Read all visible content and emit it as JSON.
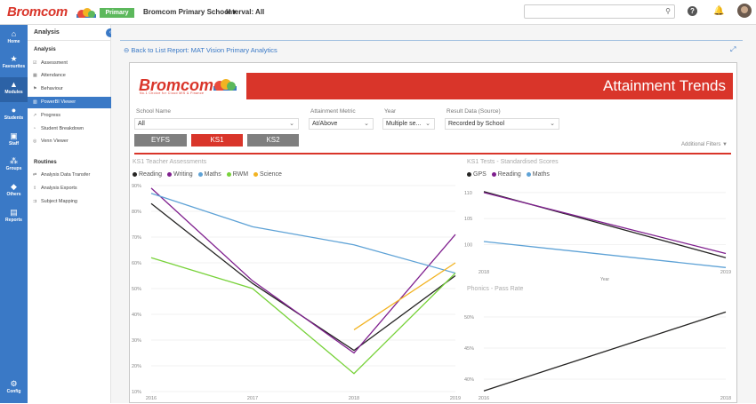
{
  "app": {
    "logo_text": "Bromcom",
    "env_badge": "Primary",
    "school_selector": "Bromcom Primary School",
    "interval": "Interval: All"
  },
  "search": {
    "placeholder": ""
  },
  "rail": [
    {
      "icon": "home-icon",
      "label": "Home"
    },
    {
      "icon": "star-icon",
      "label": "Favourites"
    },
    {
      "icon": "modules-icon",
      "label": "Modules"
    },
    {
      "icon": "students-icon",
      "label": "Students"
    },
    {
      "icon": "staff-icon",
      "label": "Staff"
    },
    {
      "icon": "groups-icon",
      "label": "Groups"
    },
    {
      "icon": "others-icon",
      "label": "Others"
    },
    {
      "icon": "reports-icon",
      "label": "Reports"
    },
    {
      "icon": "config-icon",
      "label": "Config"
    }
  ],
  "sidebar": {
    "heading": "Analysis",
    "section1": "Analysis",
    "items": [
      "Assessment",
      "Attendance",
      "Behaviour",
      "PowerBI Viewer",
      "Progress",
      "Student Breakdown",
      "Venn Viewer"
    ],
    "section2": "Routines",
    "routines": [
      "Analysis Data Transfer",
      "Analysis Exports",
      "Subject Mapping"
    ]
  },
  "content": {
    "back": "Back to List",
    "report": "Report: MAT Vision Primary Analytics"
  },
  "report": {
    "logo": "Bromcom",
    "tagline": "No.1 Choice for Cloud MIS & Finance",
    "title": "Attainment Trends",
    "filters": [
      {
        "label": "School Name",
        "value": "All"
      },
      {
        "label": "Attainment Metric",
        "value": "At/Above"
      },
      {
        "label": "Year",
        "value": "Multiple se..."
      },
      {
        "label": "Result Data (Source)",
        "value": "Recorded by School"
      }
    ],
    "stage_buttons": [
      "EYFS",
      "KS1",
      "KS2"
    ],
    "additional_filters": "Additional Filters ▼"
  },
  "colors": {
    "brand_red": "#d9352a",
    "nav_blue": "#3a79c6",
    "badge_green": "#5cb85c"
  },
  "chart_data": [
    {
      "type": "line",
      "title": "KS1 Teacher Assessments",
      "x": [
        "2016",
        "2017",
        "2018",
        "2019"
      ],
      "ylim": [
        10,
        90
      ],
      "yticks": [
        "90%",
        "80%",
        "70%",
        "60%",
        "50%",
        "40%",
        "30%",
        "20%",
        "10%"
      ],
      "series": [
        {
          "name": "Reading",
          "color": "#252423",
          "values": [
            83,
            52,
            26,
            55
          ]
        },
        {
          "name": "Writing",
          "color": "#7f1f8e",
          "values": [
            89,
            53,
            25,
            71
          ]
        },
        {
          "name": "Maths",
          "color": "#5ea2d6",
          "values": [
            87,
            74,
            67,
            56
          ]
        },
        {
          "name": "RWM",
          "color": "#78d23a",
          "values": [
            62,
            50,
            17,
            56
          ]
        },
        {
          "name": "Science",
          "color": "#f2b322",
          "values": [
            null,
            null,
            34,
            60
          ]
        }
      ]
    },
    {
      "type": "line",
      "title": "KS1 Tests - Standardised Scores",
      "x": [
        "2018",
        "2019"
      ],
      "xlabel": "Year",
      "ylim": [
        96,
        111
      ],
      "yticks": [
        "110",
        "105",
        "100"
      ],
      "series": [
        {
          "name": "GPS",
          "color": "#252423",
          "values": [
            110.2,
            97.5
          ]
        },
        {
          "name": "Reading",
          "color": "#7f1f8e",
          "values": [
            110.0,
            98.3
          ]
        },
        {
          "name": "Maths",
          "color": "#5ea2d6",
          "values": [
            100.6,
            95.6
          ]
        }
      ]
    },
    {
      "type": "line",
      "title": "Phonics - Pass Rate",
      "x": [
        "2016",
        "2018"
      ],
      "ylim": [
        38,
        52
      ],
      "yticks": [
        "50%",
        "45%",
        "40%"
      ],
      "series": [
        {
          "values": [
            38.1,
            50.8
          ]
        }
      ]
    }
  ]
}
